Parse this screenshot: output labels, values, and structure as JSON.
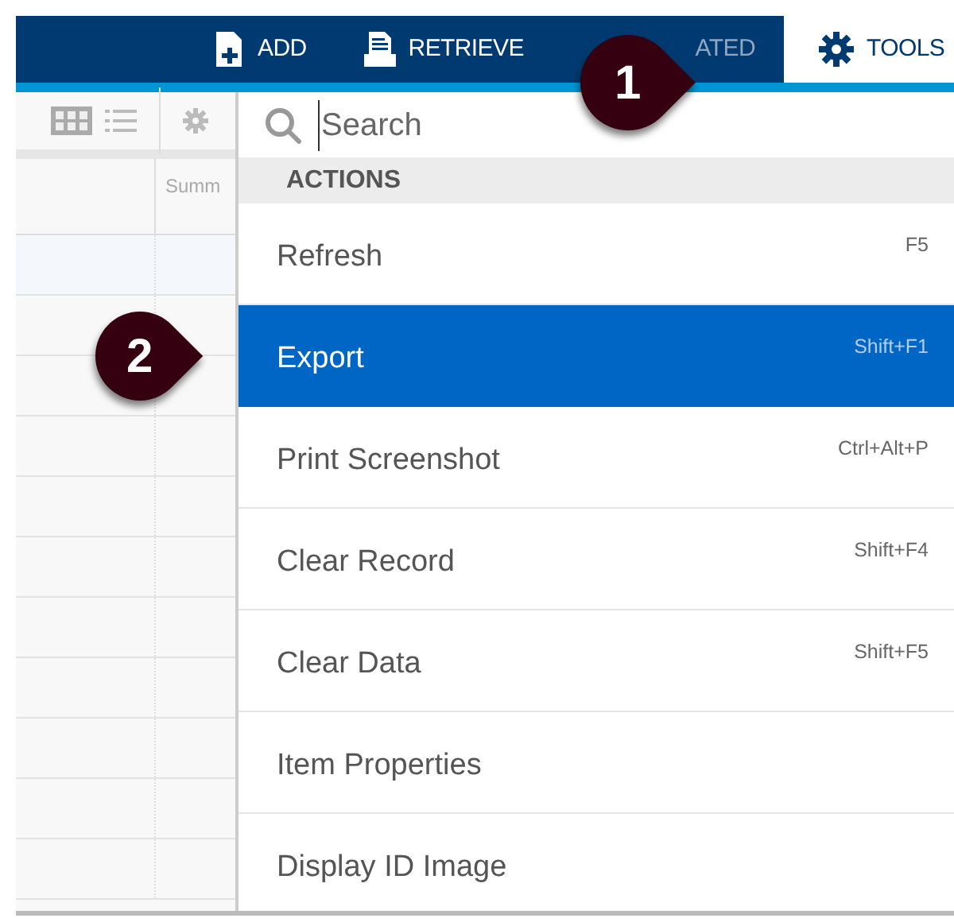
{
  "navbar": {
    "tabs": [
      {
        "label": "ADD",
        "selected": false
      },
      {
        "label": "RETRIEVE",
        "selected": false
      },
      {
        "label": "ATED",
        "selected": false
      },
      {
        "label": "TOOLS",
        "selected": true
      }
    ]
  },
  "grid": {
    "column_2": "Summ"
  },
  "tools_menu": {
    "search": {
      "placeholder": "Search"
    },
    "section": "ACTIONS",
    "items": [
      {
        "label": "Refresh",
        "shortcut": "F5",
        "selected": false
      },
      {
        "label": "Export",
        "shortcut": "Shift+F1",
        "selected": true
      },
      {
        "label": "Print Screenshot",
        "shortcut": "Ctrl+Alt+P",
        "selected": false
      },
      {
        "label": "Clear Record",
        "shortcut": "Shift+F4",
        "selected": false
      },
      {
        "label": "Clear Data",
        "shortcut": "Shift+F5",
        "selected": false
      },
      {
        "label": "Item Properties",
        "selected": false
      },
      {
        "label": "Display ID Image",
        "selected": false
      }
    ]
  },
  "callouts": [
    {
      "label": "1"
    },
    {
      "label": "2"
    }
  ]
}
